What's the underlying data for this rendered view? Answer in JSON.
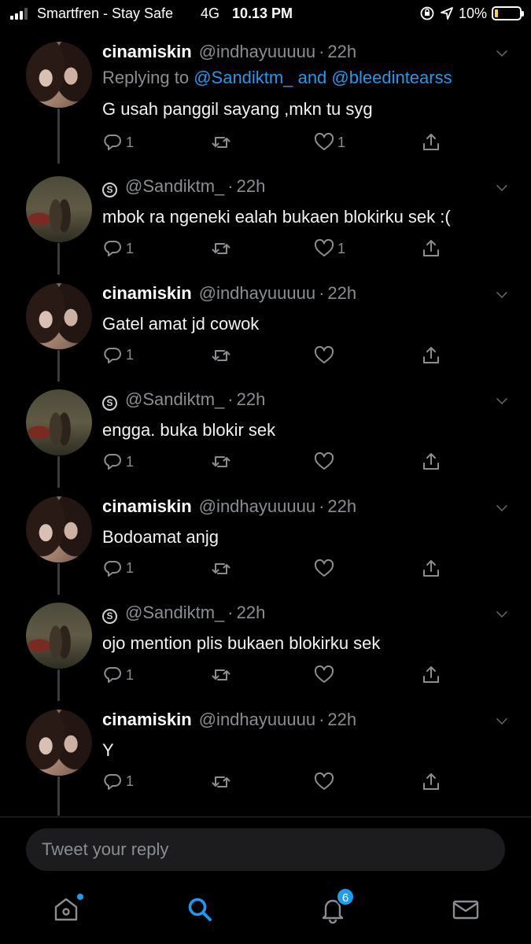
{
  "status_bar": {
    "carrier": "Smartfren - Stay Safe",
    "network": "4G",
    "time": "10.13 PM",
    "battery": "10%",
    "battery_level": 0.1
  },
  "tweets": [
    {
      "name": "cinamiskin",
      "handle": "@indhayuuuuu",
      "time": "22h",
      "replying_prefix": "Replying to",
      "replying_to": "@Sandiktm_ and @bleedintearss",
      "text": "G usah panggil sayang ,mkn tu syg",
      "replies": "1",
      "likes": "1"
    },
    {
      "handle": "@Sandiktm_",
      "blocked_badge": "S",
      "time": "22h",
      "text": "mbok ra ngeneki ealah bukaen blokirku sek :(",
      "replies": "1",
      "likes": "1"
    },
    {
      "name": "cinamiskin",
      "handle": "@indhayuuuuu",
      "time": "22h",
      "text": "Gatel amat jd cowok",
      "replies": "1",
      "likes": ""
    },
    {
      "handle": "@Sandiktm_",
      "blocked_badge": "S",
      "time": "22h",
      "text": "engga. buka blokir sek",
      "replies": "1",
      "likes": ""
    },
    {
      "name": "cinamiskin",
      "handle": "@indhayuuuuu",
      "time": "22h",
      "text": "Bodoamat anjg",
      "replies": "1",
      "likes": ""
    },
    {
      "handle": "@Sandiktm_",
      "blocked_badge": "S",
      "time": "22h",
      "text": "ojo mention plis bukaen blokirku sek",
      "replies": "1",
      "likes": ""
    },
    {
      "name": "cinamiskin",
      "handle": "@indhayuuuuu",
      "time": "22h",
      "text": "Y",
      "replies": "1",
      "likes": ""
    }
  ],
  "reply_bar": {
    "placeholder": "Tweet your reply"
  },
  "tab_bar": {
    "notifications_badge": "6",
    "accent": "#1d9bf0"
  },
  "icons": [
    "signal-icon",
    "orientation-lock-icon",
    "location-icon",
    "battery-icon",
    "chevron-down-icon",
    "reply-icon",
    "retweet-icon",
    "like-icon",
    "share-icon",
    "home-icon",
    "search-icon",
    "notifications-icon",
    "messages-icon"
  ]
}
